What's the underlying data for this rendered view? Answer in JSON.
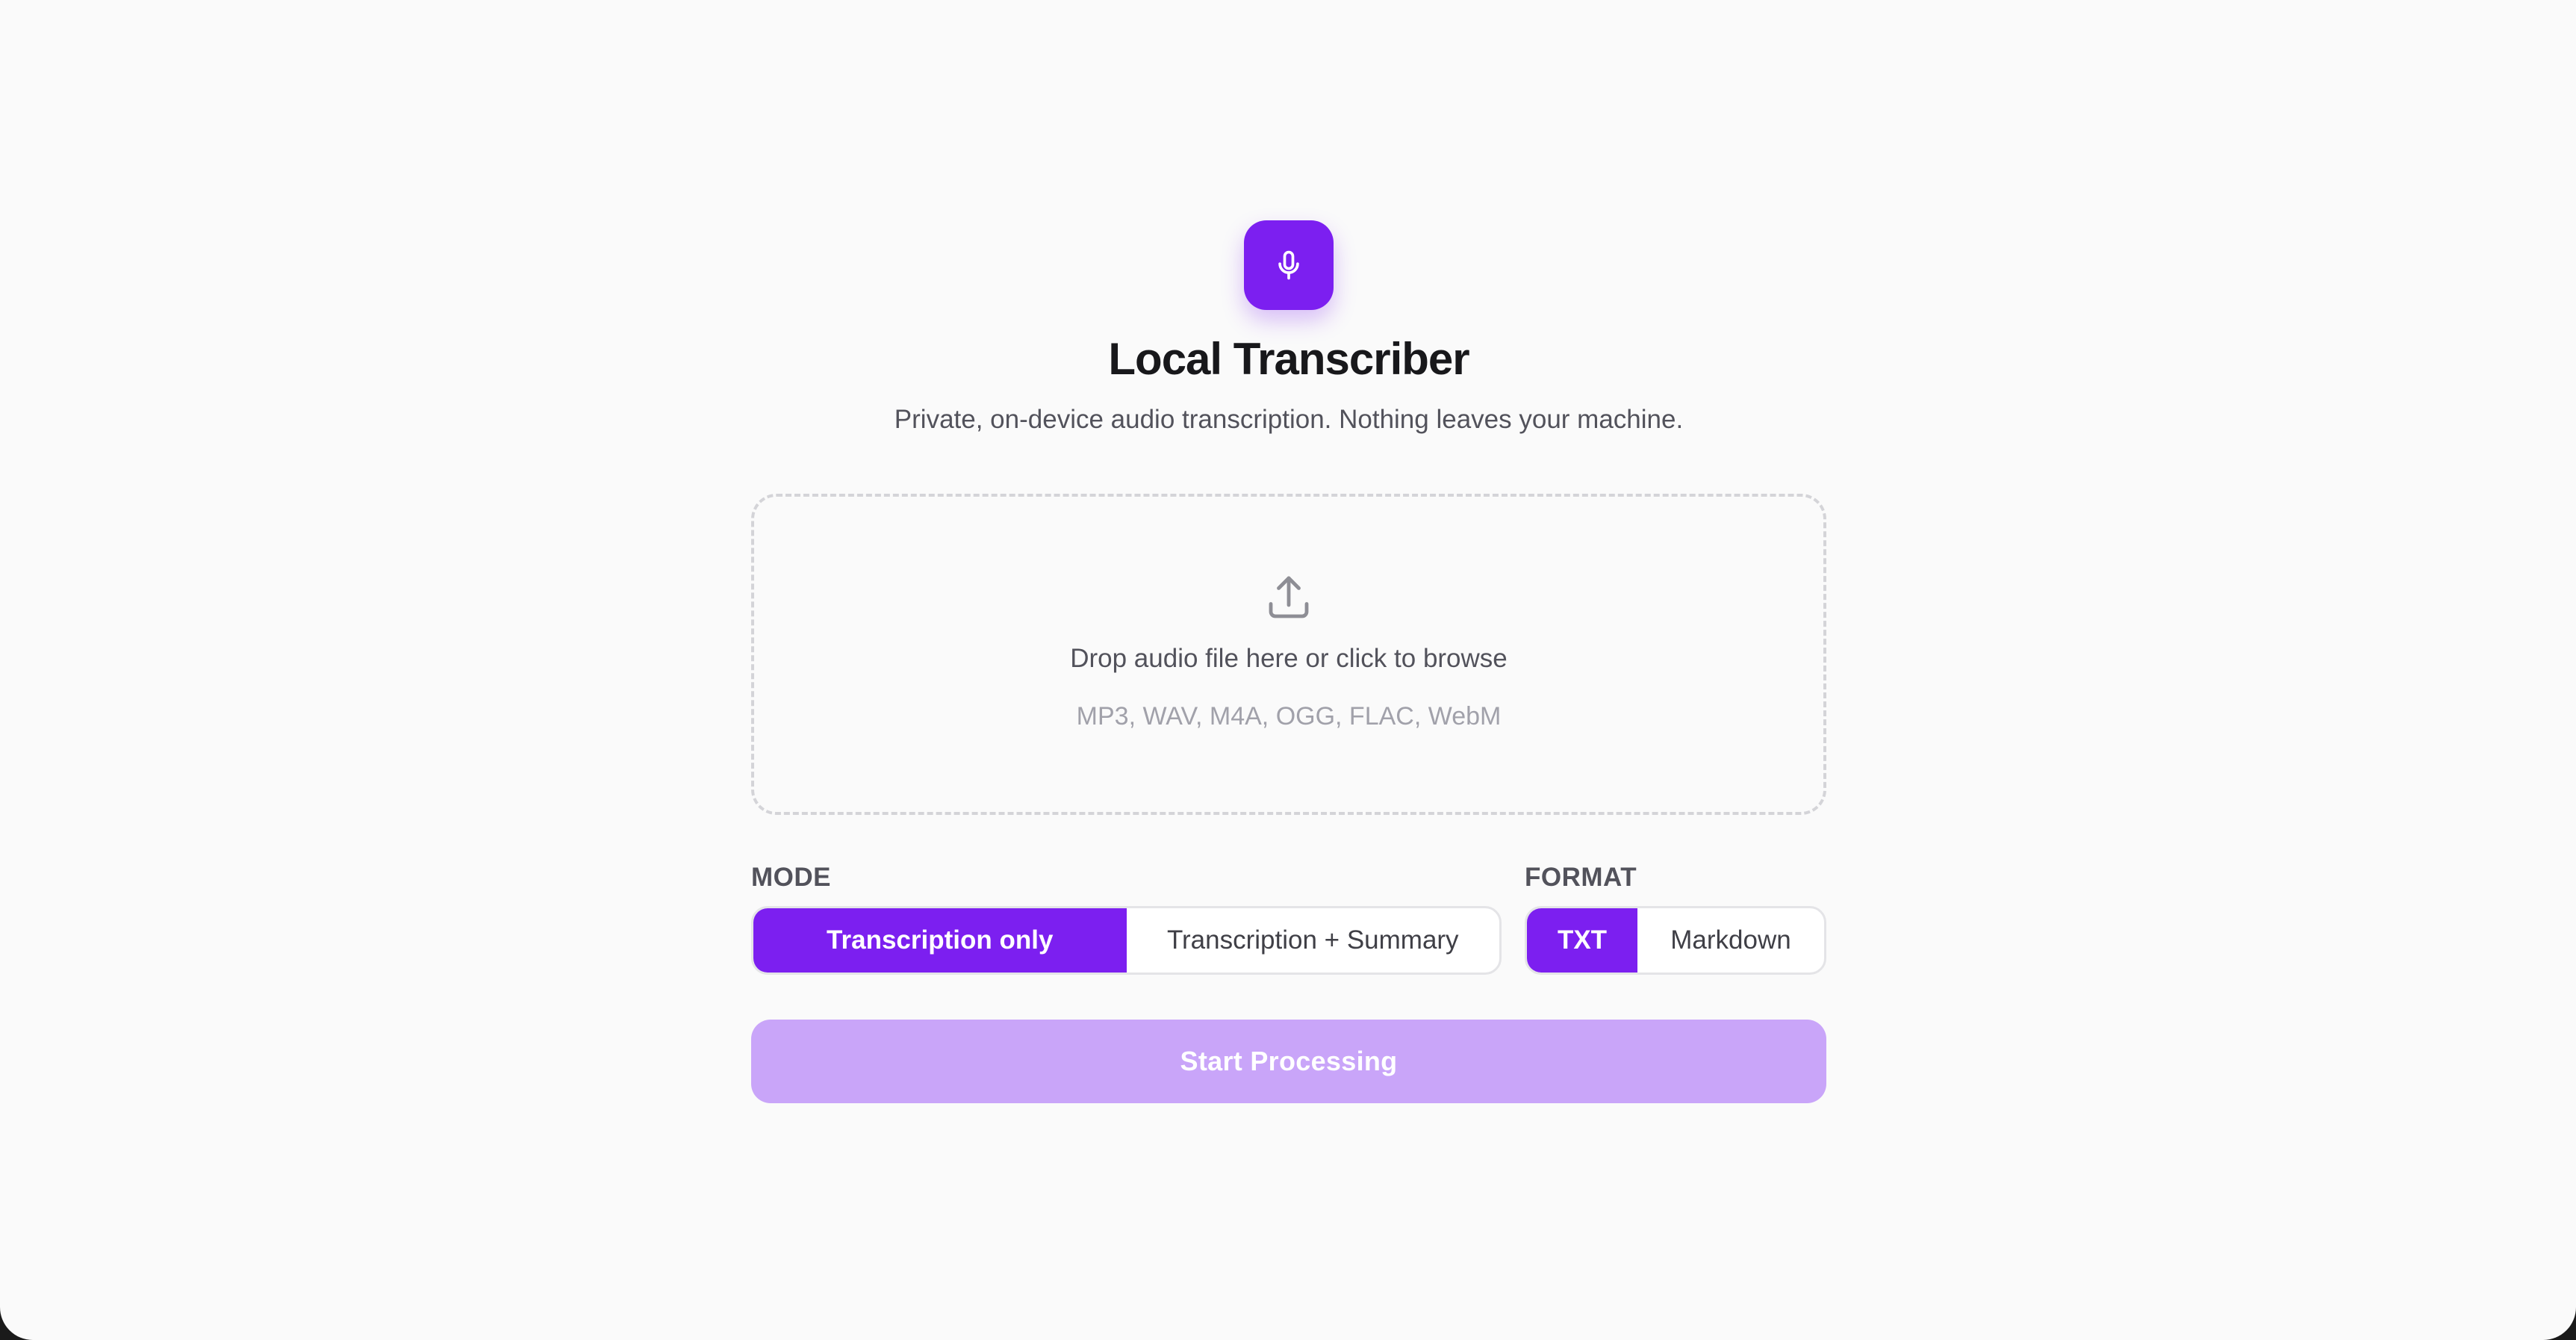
{
  "app": {
    "title": "Local Transcriber",
    "subtitle": "Private, on-device audio transcription. Nothing leaves your machine.",
    "logo_icon": "microphone-icon"
  },
  "dropzone": {
    "icon": "upload-icon",
    "primary_text": "Drop audio file here or click to browse",
    "secondary_text": "MP3, WAV, M4A, OGG, FLAC, WebM"
  },
  "mode": {
    "label": "MODE",
    "options": [
      {
        "label": "Transcription only",
        "selected": true
      },
      {
        "label": "Transcription + Summary",
        "selected": false
      }
    ]
  },
  "format": {
    "label": "FORMAT",
    "options": [
      {
        "label": "TXT",
        "selected": true
      },
      {
        "label": "Markdown",
        "selected": false
      }
    ]
  },
  "actions": {
    "start_label": "Start Processing",
    "start_enabled": false
  },
  "colors": {
    "accent": "#7c1ff0",
    "accent_disabled": "#c9a5f9",
    "background": "#fafafa"
  }
}
